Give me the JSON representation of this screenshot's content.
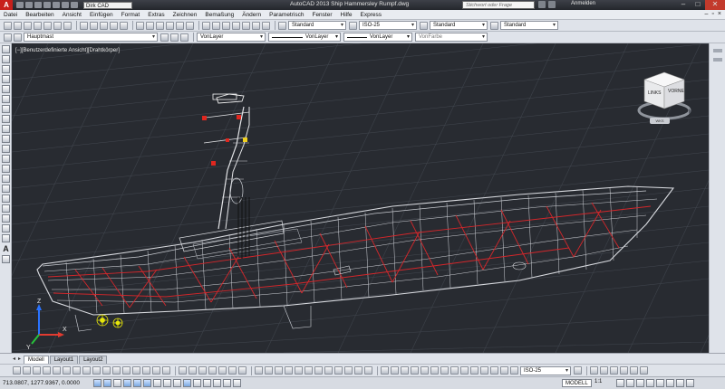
{
  "window": {
    "title": "AutoCAD 2013   Ship Hammersley Rumpf.dwg",
    "logo": "A",
    "workspace": "Dirk CAD",
    "search_placeholder": "Stichwort oder Frage eingeben",
    "login": "Anmelden",
    "controls": [
      "–",
      "□",
      "✕"
    ]
  },
  "menu": {
    "items": [
      "Datei",
      "Bearbeiten",
      "Ansicht",
      "Einfügen",
      "Format",
      "Extras",
      "Zeichnen",
      "Bemaßung",
      "Ändern",
      "Parametrisch",
      "Fenster",
      "Hilfe",
      "Express"
    ],
    "mdi_controls": [
      "–",
      "▫",
      "×"
    ]
  },
  "toolbar1": {
    "text_style": "Standard",
    "dim_style": "ISO-25",
    "table_style": "Standard",
    "multileader_style": "Standard"
  },
  "toolbar2": {
    "layer": "Hauptmast",
    "color": "VonLayer",
    "linetype": "VonLayer",
    "lineweight": "VonLayer",
    "plotstyle": "VonFarbe"
  },
  "viewport": {
    "label": "[−][Benutzerdefinierte Ansicht][Drahtkörper]",
    "viewcube": {
      "left_face": "LINKS",
      "front_face": "VORNE",
      "badge": "WKS"
    },
    "ucs_labels": {
      "x": "X",
      "y": "Y",
      "z": "Z"
    },
    "colors": {
      "background": "#282b31",
      "grid": "#3e434b",
      "hull": "#d7d9dd",
      "frames": "#d4272b",
      "propeller": "#e6e60a"
    }
  },
  "layout_tabs": {
    "nav": [
      "◂",
      "▸"
    ],
    "tabs": [
      {
        "label": "Modell",
        "active": true
      },
      {
        "label": "Layout1",
        "active": false
      },
      {
        "label": "Layout2",
        "active": false
      }
    ]
  },
  "bottom_toolbar": {
    "dim_style": "ISO-25"
  },
  "status": {
    "coordinates": "713.0807, 1277.9367, 0.0000",
    "model_button": "MODELL",
    "scale": "1:1"
  }
}
